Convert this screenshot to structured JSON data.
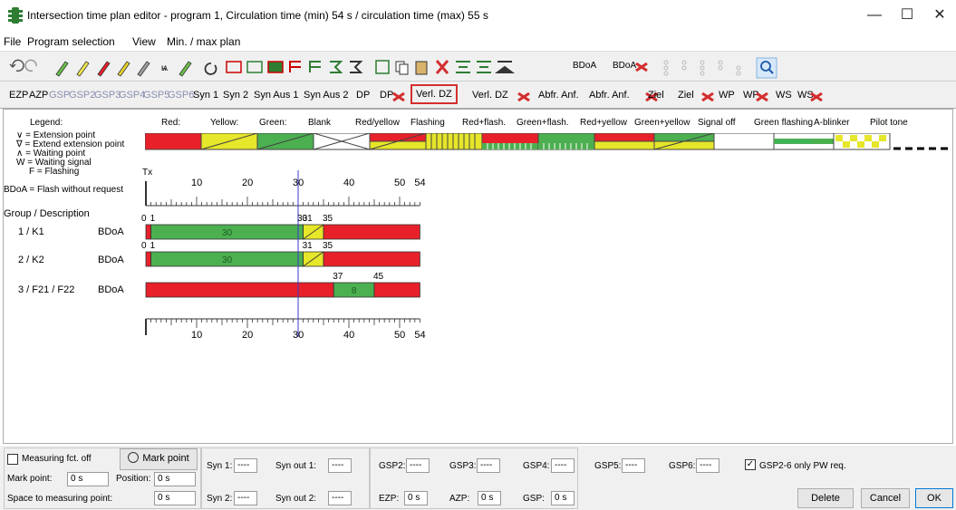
{
  "window": {
    "title": "Intersection time plan editor - program 1, Circulation time (min) 54 s / circulation time (max) 55 s",
    "minimize": "—",
    "maximize": "☐",
    "close": "✕"
  },
  "menu": [
    "File",
    "Program selection",
    "View",
    "Min. / max plan"
  ],
  "toolbar1": {
    "bdoa": "BDoA",
    "bdoa_x": "BDoA",
    "signals": "1  1  2  2"
  },
  "toolbar2": [
    {
      "label": "EZP",
      "gray": false
    },
    {
      "label": "AZP",
      "gray": false
    },
    {
      "label": "GSP",
      "gray": true
    },
    {
      "label": "GSP2",
      "gray": true
    },
    {
      "label": "GSP3",
      "gray": true
    },
    {
      "label": "GSP4",
      "gray": true
    },
    {
      "label": "GSP5",
      "gray": true
    },
    {
      "label": "GSP6",
      "gray": true
    },
    {
      "label": "Syn 1",
      "gray": false
    },
    {
      "label": "Syn 2",
      "gray": false
    },
    {
      "label": "Syn Aus 1",
      "gray": false
    },
    {
      "label": "Syn Aus 2",
      "gray": false
    },
    {
      "label": "DP",
      "gray": false
    },
    {
      "label": "DP",
      "gray": false,
      "x": true
    },
    {
      "label": "Verl. DZ",
      "gray": false,
      "boxed": true
    },
    {
      "label": "Verl. DZ",
      "gray": false,
      "x": true
    },
    {
      "label": "Abfr. Anf.",
      "gray": false
    },
    {
      "label": "Abfr. Anf.",
      "gray": false,
      "x": true
    },
    {
      "label": "Ziel",
      "gray": false
    },
    {
      "label": "Ziel",
      "gray": false,
      "x": true
    },
    {
      "label": "WP",
      "gray": false
    },
    {
      "label": "WP",
      "gray": false,
      "x": true
    },
    {
      "label": "WS",
      "gray": false
    },
    {
      "label": "WS",
      "gray": false,
      "x": true
    }
  ],
  "legend": {
    "title": "Legend:",
    "items": [
      "Red:",
      "Yellow:",
      "Green:",
      "Blank",
      "Red/yellow",
      "Flashing",
      "Red+flash.",
      "Green+flash.",
      "Red+yellow",
      "Green+yellow",
      "Signal off",
      "Green flashing",
      "A-blinker",
      "Pilot tone"
    ],
    "keys": [
      "∨ = Extension point",
      "∇ = Extend extension point",
      "∧ = Waiting point",
      "W = Waiting signal",
      "F = Flashing",
      "BDoA = Flash without request"
    ],
    "colors": {
      "red": "#e8202a",
      "yellow": "#e6e62a",
      "green": "#4caf50",
      "white": "#ffffff"
    }
  },
  "axis": {
    "tx": "Tx",
    "ticks": [
      "0",
      "10",
      "20",
      "30",
      "40",
      "50",
      "54"
    ],
    "bottom_ticks": [
      "0",
      "10",
      "20",
      "30",
      "40",
      "50",
      "54"
    ]
  },
  "groups_header": "Group / Description",
  "groups": [
    {
      "name": "1 / K1",
      "bdoa": "BDoA",
      "marks": [
        "0",
        "1",
        "30",
        "31",
        "35"
      ],
      "segments": [
        {
          "from": 0,
          "to": 1,
          "color": "red"
        },
        {
          "from": 1,
          "to": 31,
          "color": "green",
          "label": "30"
        },
        {
          "from": 31,
          "to": 35,
          "color": "yellow"
        },
        {
          "from": 35,
          "to": 54,
          "color": "red"
        }
      ]
    },
    {
      "name": "2 / K2",
      "bdoa": "BDoA",
      "marks": [
        "0",
        "1",
        "31",
        "35"
      ],
      "segments": [
        {
          "from": 0,
          "to": 1,
          "color": "red"
        },
        {
          "from": 1,
          "to": 31,
          "color": "green",
          "label": "30"
        },
        {
          "from": 31,
          "to": 35,
          "color": "yellow"
        },
        {
          "from": 35,
          "to": 54,
          "color": "red"
        }
      ]
    },
    {
      "name": "3 / F21 / F22",
      "bdoa": "BDoA",
      "marks": [
        "37",
        "45"
      ],
      "segments": [
        {
          "from": 0,
          "to": 37,
          "color": "red"
        },
        {
          "from": 37,
          "to": 45,
          "color": "green",
          "label": "8"
        },
        {
          "from": 45,
          "to": 54,
          "color": "red"
        }
      ]
    }
  ],
  "bottom": {
    "measuring": "Measuring fct. off",
    "mark_point_btn": "Mark point",
    "mark_point_label": "Mark point:",
    "mark_point_value": "0 s",
    "position_label": "Position:",
    "position_value": "0 s",
    "space_label": "Space to measuring point:",
    "space_value": "0 s",
    "syn1_label": "Syn 1:",
    "syn1_value": "----",
    "synout1_label": "Syn out 1:",
    "synout1_value": "----",
    "syn2_label": "Syn 2:",
    "syn2_value": "----",
    "synout2_label": "Syn out 2:",
    "synout2_value": "----",
    "gsp2_label": "GSP2:",
    "gsp2_value": "----",
    "gsp3_label": "GSP3:",
    "gsp3_value": "----",
    "gsp4_label": "GSP4:",
    "gsp4_value": "----",
    "gsp5_label": "GSP5:",
    "gsp5_value": "----",
    "gsp6_label": "GSP6:",
    "gsp6_value": "----",
    "gsp_only": "GSP2-6 only PW req.",
    "ezp_label": "EZP:",
    "ezp_value": "0 s",
    "azp_label": "AZP:",
    "azp_value": "0 s",
    "gsp_label": "GSP:",
    "gsp_value": "0 s",
    "delete": "Delete",
    "cancel": "Cancel",
    "ok": "OK"
  }
}
